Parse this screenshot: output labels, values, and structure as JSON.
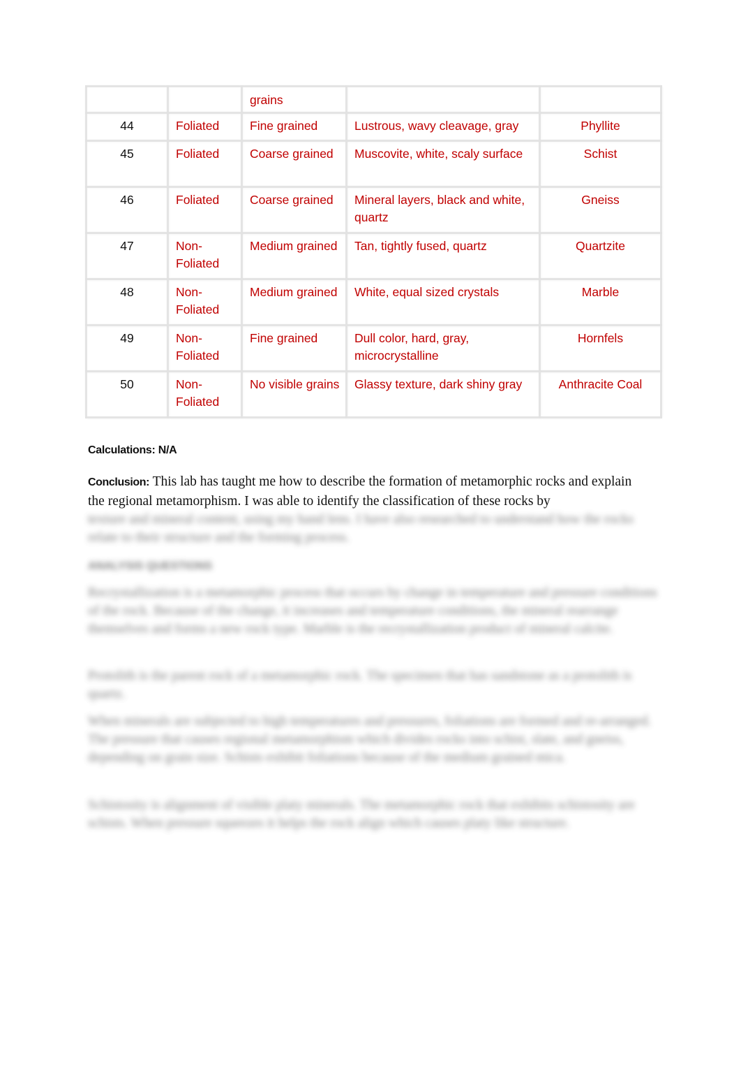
{
  "table": {
    "continuation_row": [
      "",
      "",
      "grains",
      "",
      ""
    ],
    "rows": [
      {
        "number": "44",
        "foliation": "Foliated",
        "texture": "Fine grained",
        "description": "Lustrous, wavy cleavage, gray",
        "rock_name": "Phyllite"
      },
      {
        "number": "45",
        "foliation": "Foliated",
        "texture": "Coarse grained",
        "description": "Muscovite, white, scaly surface",
        "rock_name": "Schist"
      },
      {
        "number": "46",
        "foliation": "Foliated",
        "texture": "Coarse grained",
        "description": "Mineral layers, black and white, quartz",
        "rock_name": "Gneiss"
      },
      {
        "number": "47",
        "foliation": "Non-Foliated",
        "texture": "Medium grained",
        "description": "Tan, tightly fused, quartz",
        "rock_name": "Quartzite"
      },
      {
        "number": "48",
        "foliation": "Non-Foliated",
        "texture": "Medium grained",
        "description": "White, equal sized crystals",
        "rock_name": "Marble"
      },
      {
        "number": "49",
        "foliation": "Non-Foliated",
        "texture": "Fine grained",
        "description": "Dull color, hard, gray, microcrystalline",
        "rock_name": "Hornfels"
      },
      {
        "number": "50",
        "foliation": "Non-Foliated",
        "texture": "No visible grains",
        "description": "Glassy texture, dark shiny gray",
        "rock_name": "Anthracite Coal"
      }
    ]
  },
  "calculations": "Calculations: N/A",
  "conclusion": {
    "label": "Conclusion:",
    "text": " This lab has taught me how to describe the formation of metamorphic rocks and explain the regional metamorphism. I was able to identify the classification of these rocks by"
  },
  "blurred_content": {
    "p1": "texture and mineral content, using my hand lens. I have also researched to understand how the rocks relate to their structure and the forming process.",
    "heading": "ANALYSIS QUESTIONS",
    "p2": "Recrystallization is a metamorphic process that occurs by change in temperature and pressure conditions of the rock. Because of the change, it increases and temperature conditions, the mineral rearrange themselves and forms a new rock type. Marble is the recrystallization product of mineral calcite.",
    "p3": "Protolith is the parent rock of a metamorphic rock. The specimen that has sandstone as a protolith is quartz.",
    "p4": "When minerals are subjected to high temperatures and pressures, foliations are formed and re-arranged. The pressure that causes regional metamorphism which divides rocks into schist, slate, and gneiss, depending on grain size. Schists exhibit foliations because of the medium grained mica.",
    "p5": "Schistosity is alignment of visible platy minerals. The metamorphic rock that exhibits schistosity are schists. When pressure squeezes it helps the rock align which causes platy like structure."
  },
  "colors": {
    "cell_text": "#c00000",
    "number_text": "#111111",
    "grid": "#e1e1e1"
  }
}
